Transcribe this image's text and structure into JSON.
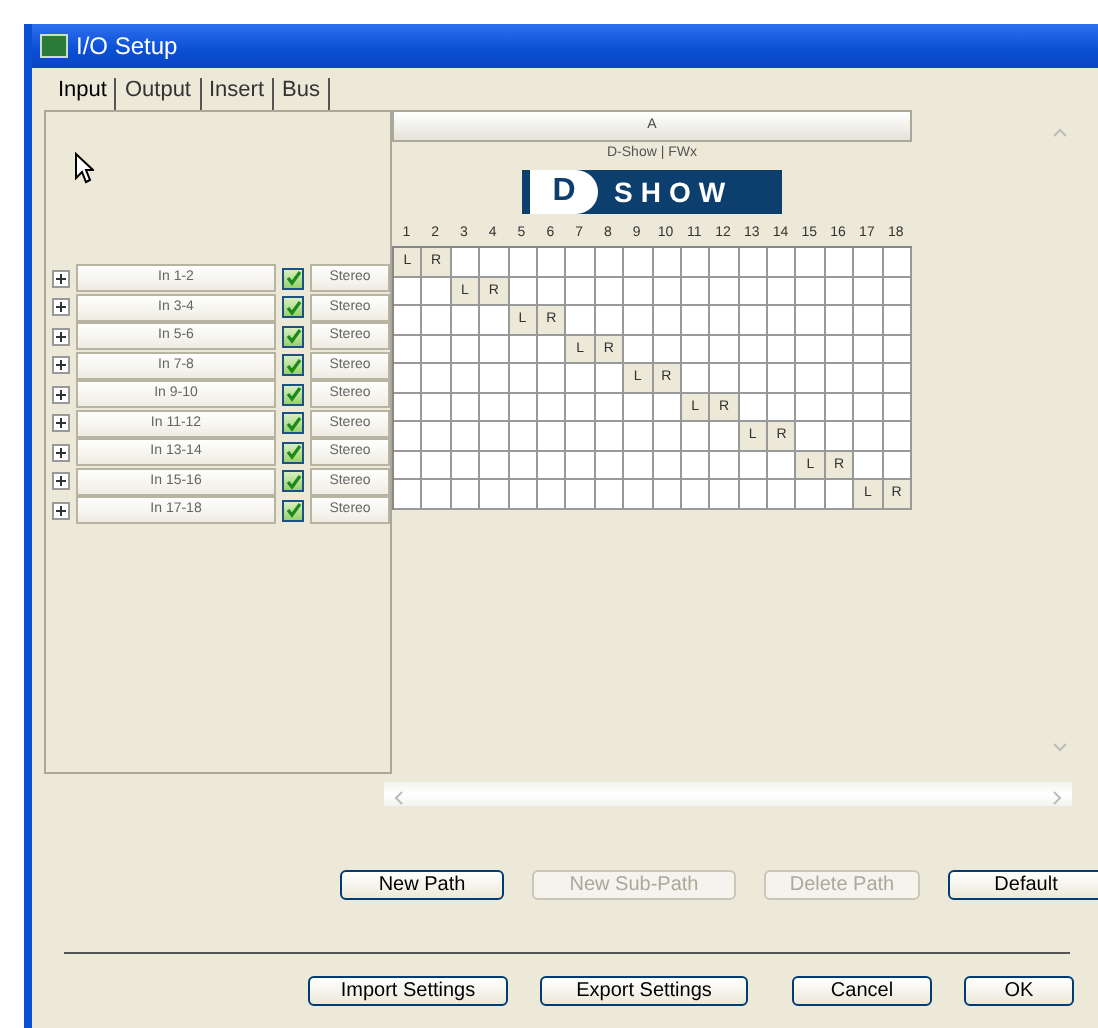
{
  "window": {
    "title": "I/O Setup"
  },
  "tabs": [
    {
      "label": "Input",
      "selected": true
    },
    {
      "label": "Output",
      "selected": false
    },
    {
      "label": "Insert",
      "selected": false
    },
    {
      "label": "Bus",
      "selected": false
    }
  ],
  "matrix": {
    "group": "A",
    "device": "D-Show | FWx",
    "logo": {
      "mark": "D",
      "text": "SHOW"
    },
    "columns": [
      "1",
      "2",
      "3",
      "4",
      "5",
      "6",
      "7",
      "8",
      "9",
      "10",
      "11",
      "12",
      "13",
      "14",
      "15",
      "16",
      "17",
      "18"
    ],
    "rows": [
      {
        "name": "In 1-2",
        "expanded": false,
        "checked": true,
        "format": "Stereo",
        "cells": [
          "L",
          "R",
          null,
          null,
          null,
          null,
          null,
          null,
          null,
          null,
          null,
          null,
          null,
          null,
          null,
          null,
          null,
          null
        ]
      },
      {
        "name": "In 3-4",
        "expanded": false,
        "checked": true,
        "format": "Stereo",
        "cells": [
          null,
          null,
          "L",
          "R",
          null,
          null,
          null,
          null,
          null,
          null,
          null,
          null,
          null,
          null,
          null,
          null,
          null,
          null
        ]
      },
      {
        "name": "In 5-6",
        "expanded": false,
        "checked": true,
        "format": "Stereo",
        "cells": [
          null,
          null,
          null,
          null,
          "L",
          "R",
          null,
          null,
          null,
          null,
          null,
          null,
          null,
          null,
          null,
          null,
          null,
          null
        ]
      },
      {
        "name": "In 7-8",
        "expanded": false,
        "checked": true,
        "format": "Stereo",
        "cells": [
          null,
          null,
          null,
          null,
          null,
          null,
          "L",
          "R",
          null,
          null,
          null,
          null,
          null,
          null,
          null,
          null,
          null,
          null
        ]
      },
      {
        "name": "In 9-10",
        "expanded": false,
        "checked": true,
        "format": "Stereo",
        "cells": [
          null,
          null,
          null,
          null,
          null,
          null,
          null,
          null,
          "L",
          "R",
          null,
          null,
          null,
          null,
          null,
          null,
          null,
          null
        ]
      },
      {
        "name": "In 11-12",
        "expanded": false,
        "checked": true,
        "format": "Stereo",
        "cells": [
          null,
          null,
          null,
          null,
          null,
          null,
          null,
          null,
          null,
          null,
          "L",
          "R",
          null,
          null,
          null,
          null,
          null,
          null
        ]
      },
      {
        "name": "In 13-14",
        "expanded": false,
        "checked": true,
        "format": "Stereo",
        "cells": [
          null,
          null,
          null,
          null,
          null,
          null,
          null,
          null,
          null,
          null,
          null,
          null,
          "L",
          "R",
          null,
          null,
          null,
          null
        ]
      },
      {
        "name": "In 15-16",
        "expanded": false,
        "checked": true,
        "format": "Stereo",
        "cells": [
          null,
          null,
          null,
          null,
          null,
          null,
          null,
          null,
          null,
          null,
          null,
          null,
          null,
          null,
          "L",
          "R",
          null,
          null
        ]
      },
      {
        "name": "In 17-18",
        "expanded": false,
        "checked": true,
        "format": "Stereo",
        "cells": [
          null,
          null,
          null,
          null,
          null,
          null,
          null,
          null,
          null,
          null,
          null,
          null,
          null,
          null,
          null,
          null,
          "L",
          "R"
        ]
      }
    ]
  },
  "path_buttons": [
    {
      "label": "New Path",
      "disabled": false
    },
    {
      "label": "New Sub-Path",
      "disabled": true
    },
    {
      "label": "Delete Path",
      "disabled": true
    },
    {
      "label": "Default",
      "disabled": false
    }
  ],
  "dialog_buttons": [
    {
      "label": "Import Settings",
      "disabled": false
    },
    {
      "label": "Export Settings",
      "disabled": false
    },
    {
      "label": "Cancel",
      "disabled": false
    },
    {
      "label": "OK",
      "disabled": false
    }
  ]
}
